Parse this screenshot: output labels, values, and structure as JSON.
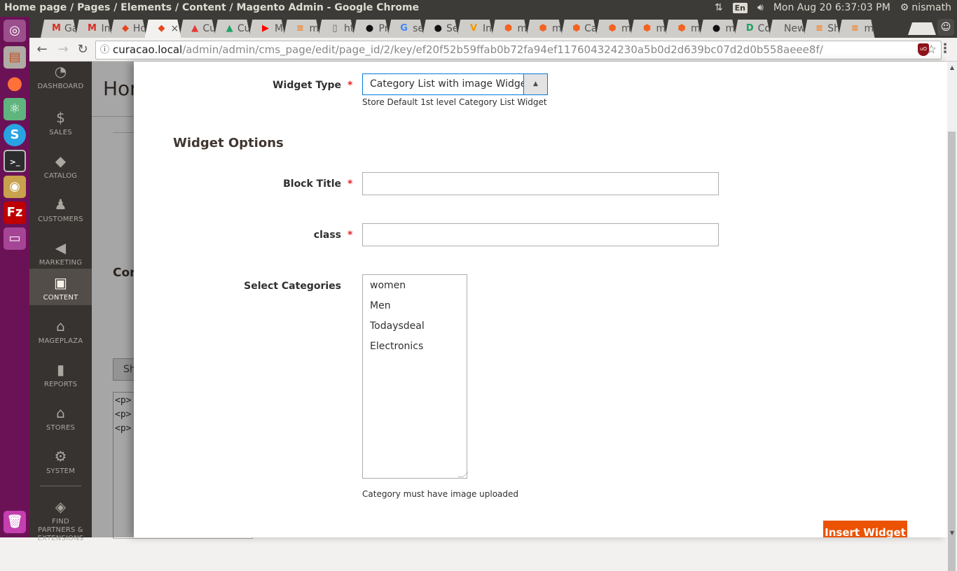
{
  "os_topbar": {
    "window_title": "Home page / Pages / Elements / Content / Magento Admin - Google Chrome",
    "keyboard_layout": "En",
    "datetime": "Mon Aug 20  6:37:03 PM",
    "username": "nismath"
  },
  "browser": {
    "tabs": [
      {
        "icon": "gmail-icon",
        "glyph": "M",
        "color": "#d93025",
        "label": "Ga"
      },
      {
        "icon": "gmail-icon",
        "glyph": "M",
        "color": "#d93025",
        "label": "In"
      },
      {
        "icon": "magento-icon",
        "glyph": "◆",
        "color": "#e6461e",
        "label": "Ho"
      },
      {
        "icon": "magento-icon",
        "glyph": "◆",
        "color": "#e6461e",
        "label": "×",
        "active": true
      },
      {
        "icon": "image-icon",
        "glyph": "▲",
        "color": "#e53935",
        "label": "Cu"
      },
      {
        "icon": "drive-icon",
        "glyph": "▲",
        "color": "#1fa463",
        "label": "Cu"
      },
      {
        "icon": "youtube-icon",
        "glyph": "▶",
        "color": "#ff0000",
        "label": "M"
      },
      {
        "icon": "stackoverflow-icon",
        "glyph": "≡",
        "color": "#f48024",
        "label": "m"
      },
      {
        "icon": "document-icon",
        "glyph": "▯",
        "color": "#666666",
        "label": "ht"
      },
      {
        "icon": "github-icon",
        "glyph": "●",
        "color": "#111111",
        "label": "Pr"
      },
      {
        "icon": "google-icon",
        "glyph": "G",
        "color": "#4285f4",
        "label": "se"
      },
      {
        "icon": "github-icon",
        "glyph": "●",
        "color": "#111111",
        "label": "Se"
      },
      {
        "icon": "typo3-icon",
        "glyph": "V",
        "color": "#f49700",
        "label": "In"
      },
      {
        "icon": "magento-hex-icon",
        "glyph": "⬢",
        "color": "#f26322",
        "label": "m"
      },
      {
        "icon": "magento-hex-icon",
        "glyph": "⬢",
        "color": "#f26322",
        "label": "m"
      },
      {
        "icon": "magento-hex-icon",
        "glyph": "⬢",
        "color": "#f26322",
        "label": "Ca"
      },
      {
        "icon": "magento-hex-icon",
        "glyph": "⬢",
        "color": "#f26322",
        "label": "m"
      },
      {
        "icon": "magento-hex-icon",
        "glyph": "⬢",
        "color": "#f26322",
        "label": "m"
      },
      {
        "icon": "magento-hex-icon",
        "glyph": "⬢",
        "color": "#f26322",
        "label": "m"
      },
      {
        "icon": "github-icon",
        "glyph": "●",
        "color": "#111111",
        "label": "m"
      },
      {
        "icon": "d-icon",
        "glyph": "D",
        "color": "#1aa260",
        "label": "Co"
      },
      {
        "icon": "none",
        "glyph": "",
        "color": "#555555",
        "label": "New"
      },
      {
        "icon": "stackoverflow-icon",
        "glyph": "≡",
        "color": "#f48024",
        "label": "Sh"
      },
      {
        "icon": "stackoverflow-icon",
        "glyph": "≡",
        "color": "#f48024",
        "label": "m"
      }
    ],
    "url_host": "curacao.local",
    "url_path": "/admin/admin/cms_page/edit/page_id/2/key/ef20f52b59ffab0b72fa94ef117604324230a5b0d2d639bc07d2d0b558aeee8f/"
  },
  "admin_nav": {
    "items": [
      {
        "label": "DASHBOARD",
        "icon": "dashboard-icon",
        "glyph": "◔"
      },
      {
        "label": "SALES",
        "icon": "dollar-icon",
        "glyph": "$"
      },
      {
        "label": "CATALOG",
        "icon": "box-icon",
        "glyph": "◆"
      },
      {
        "label": "CUSTOMERS",
        "icon": "person-icon",
        "glyph": "♟"
      },
      {
        "label": "MARKETING",
        "icon": "megaphone-icon",
        "glyph": "◀"
      },
      {
        "label": "CONTENT",
        "icon": "layout-icon",
        "glyph": "▣",
        "active": true
      },
      {
        "label": "MAGEPLAZA",
        "icon": "mageplaza-icon",
        "glyph": "⌂"
      },
      {
        "label": "REPORTS",
        "icon": "bar-chart-icon",
        "glyph": "▮"
      },
      {
        "label": "STORES",
        "icon": "store-icon",
        "glyph": "⌂"
      },
      {
        "label": "SYSTEM",
        "icon": "gear-icon",
        "glyph": "⚙"
      },
      {
        "label": "FIND PARTNERS & EXTENSIONS",
        "icon": "lego-icon",
        "glyph": "◈"
      }
    ]
  },
  "background_page": {
    "title_fragment": "Hor",
    "content_heading_fragment": "Con",
    "show_button_fragment": "Sh",
    "editor_lines": [
      "<p>",
      "<p>",
      "<p>"
    ]
  },
  "modal": {
    "widget_type": {
      "label": "Widget Type",
      "value": "Category List with image Widget",
      "note": "Store Default 1st level Category List Widget"
    },
    "section_title": "Widget Options",
    "block_title": {
      "label": "Block Title",
      "value": ""
    },
    "class_field": {
      "label": "class",
      "value": ""
    },
    "select_categories": {
      "label": "Select Categories",
      "options": [
        "women",
        "Men",
        "Todaysdeal",
        "Electronics"
      ],
      "note": "Category must have image uploaded"
    },
    "insert_button": "Insert Widget"
  },
  "colors": {
    "accent_orange": "#eb5202",
    "focus_blue": "#007bdb",
    "required_red": "#e22626",
    "admin_nav_bg": "#373330",
    "launcher_bg": "#6b1257"
  }
}
